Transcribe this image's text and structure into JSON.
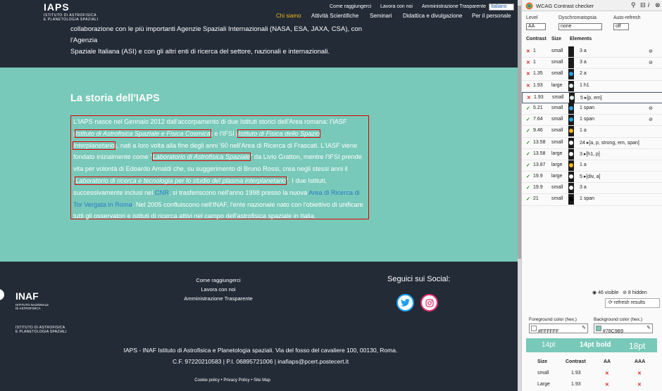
{
  "site": {
    "logo": {
      "title": "IAPS",
      "subtitle_line1": "ISTITUTO DI ASTROFISICA",
      "subtitle_line2": "E PLANETOLOGIA SPAZIALI"
    },
    "util_links": [
      "Come raggiungerci",
      "Lavora con noi",
      "Amministrazione Trasparente"
    ],
    "language": "Italiano",
    "nav": [
      "Chi siamo",
      "Attività Scientifiche",
      "Seminari",
      "Didattica e divulgazione",
      "Per il personale"
    ],
    "intro_line1": "collaborazione con le più importanti Agenzie Spaziali Internazionali (NASA, ESA, JAXA, CSA), con l'Agenzia",
    "intro_line2": "Spaziale Italiana (ASI) e con gli altri enti di ricerca del settore, nazionali e internazionali.",
    "history": {
      "title": "La storia dell'IAPS",
      "p_a": "L'IAPS nasce nel Gennaio 2012 dall'accorpamento di due Istituti storici dell'Area romana: l'IASF (",
      "em1": "Istituto di Astrofisica Spaziale e Fisica Cosmica",
      "p_b": ") e l'IFSI (",
      "em2": "Istituto di Fisica dello Spazio Interplanetario",
      "p_c": "), nati a loro volta alla fine degli anni '60 nell'Area di Ricerca di Frascati. L'IASF viene fondato inizialmente come \"",
      "em3": "Laboratorio di Astrofisica Spaziale",
      "p_d": "\" da Livio Gratton, mentre l'IFSI prende vita per volontà di Edoardo Amaldi che, su suggerimento di Bruno Rossi, crea negli stessi anni il \"",
      "em4": "Laboratorio di ricerca e tecnologia per lo studio del plasma interplanetario",
      "p_e": "\". I due Istituti, successivamente inclusi nel ",
      "link1": "CNR",
      "p_f": ", si trasferiscono nell'anno 1998 presso la nuova ",
      "link2": "Area di Ricerca di Tor Vergata in Roma",
      "p_g": ". Nel 2005 confluiscono nell'INAF, l'ente nazionale nato con l'obiettivo di unificare tutti gli osservatori e istituti di ricerca attivi nel campo dell'astrofisica spaziale in Italia."
    },
    "footer": {
      "inaf": "INAF",
      "inaf_sub1": "ISTITUTO NAZIONALE",
      "inaf_sub2": "DI ASTROFISICA",
      "iaps_sub1": "ISTITUTO DI ASTROFISICA",
      "iaps_sub2": "E PLANETOLOGIA SPAZIALI",
      "links": [
        "Come raggiungerci",
        "Lavora con noi",
        "Amministrazione Trasparente"
      ],
      "social_title": "Seguici sui Social:",
      "address_line1": "IAPS - INAF Istituto di Astrofisica e Planetologia spaziali. Via del fosso del cavaliere 100, 00130, Roma.",
      "address_line2": "C.F. 97220210583 | P.I. 06895721006 | inafiaps@pcert.postecert.it",
      "legal": "Cookie policy  •  Privacy Policy  •  Site Map"
    }
  },
  "checker": {
    "title": "WCAG Contrast checker",
    "level_label": "Level",
    "level_value": "AA",
    "dys_label": "Dyschromatopsia",
    "dys_value": "none",
    "auto_label": "Auto-refresh",
    "auto_value": "off",
    "col_contrast": "Contrast",
    "col_size": "Size",
    "col_elements": "Elements",
    "rows": [
      {
        "pass": false,
        "contrast": "1",
        "size": "small",
        "dot": "#1a1a1a",
        "elements": "3 a",
        "eye": true
      },
      {
        "pass": false,
        "contrast": "1",
        "size": "small",
        "dot": "#1a1a1a",
        "elements": "3 a",
        "eye": true
      },
      {
        "pass": false,
        "contrast": "1.35",
        "size": "small",
        "dot": "#2a9fd8",
        "elements": "2 a",
        "eye": false
      },
      {
        "pass": false,
        "contrast": "1.93",
        "size": "large",
        "dot": "#e0f4ef",
        "elements": "1 h1",
        "eye": false
      },
      {
        "pass": false,
        "contrast": "1.93",
        "size": "small",
        "dot": "#e0f4ef",
        "elements": "5 ▸[p, em]",
        "eye": false
      },
      {
        "pass": true,
        "contrast": "5.21",
        "size": "small",
        "dot": "#2a9fd8",
        "elements": "1 span",
        "eye": true
      },
      {
        "pass": true,
        "contrast": "7.64",
        "size": "small",
        "dot": "#2a9fd8",
        "elements": "1 span",
        "eye": true
      },
      {
        "pass": true,
        "contrast": "9.46",
        "size": "small",
        "dot": "#f5b91e",
        "elements": "1 a",
        "eye": false
      },
      {
        "pass": true,
        "contrast": "13.58",
        "size": "small",
        "dot": "#ffffff",
        "elements": "24 ▸[a, p, strong, em, span]",
        "eye": false
      },
      {
        "pass": true,
        "contrast": "13.58",
        "size": "large",
        "dot": "#ffffff",
        "elements": "3 ▸[h1, p]",
        "eye": false
      },
      {
        "pass": true,
        "contrast": "13.87",
        "size": "large",
        "dot": "#f5b91e",
        "elements": "1 a",
        "eye": false
      },
      {
        "pass": true,
        "contrast": "19.9",
        "size": "large",
        "dot": "#ffffff",
        "elements": "5 ▸[div, a]",
        "eye": false
      },
      {
        "pass": true,
        "contrast": "19.9",
        "size": "small",
        "dot": "#ffffff",
        "elements": "3 a",
        "eye": false
      },
      {
        "pass": true,
        "contrast": "21",
        "size": "small",
        "dot": "#000000",
        "elements": "1 span",
        "eye": false
      }
    ],
    "visible": "46 visible",
    "hidden": "8 hidden",
    "refresh": "refresh results",
    "fg_label": "Foreground color (hex.)",
    "fg_value": "#FFFFFF",
    "bg_label": "Background color (hex.)",
    "bg_value": "#78C9B9",
    "preview": [
      "14pt",
      "14pt bold",
      "18pt"
    ],
    "result_headers": [
      "Size",
      "Contrast",
      "AA",
      "AAA"
    ],
    "results": [
      {
        "size": "small",
        "contrast": "1.93",
        "aa": "✕",
        "aaa": "✕"
      },
      {
        "size": "Large",
        "contrast": "1.93",
        "aa": "✕",
        "aaa": "✕"
      }
    ],
    "colors": {
      "teal": "#78C9B9",
      "dark": "#232B37",
      "fail": "#DD2222",
      "pass": "#1E8A1E"
    }
  }
}
